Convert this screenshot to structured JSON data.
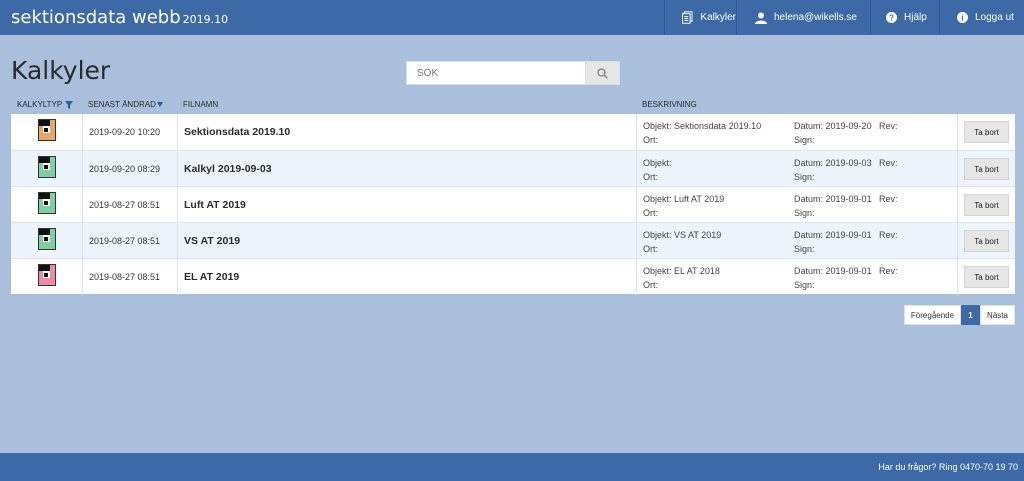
{
  "app": {
    "brand": "sektionsdata webb",
    "version": "2019.10"
  },
  "nav": {
    "calculations": "Kalkyler",
    "user": "helena@wikells.se",
    "help": "Hjälp",
    "logout": "Logga ut"
  },
  "page": {
    "title": "Kalkyler"
  },
  "search": {
    "placeholder": "SÖK"
  },
  "columns": {
    "type": "KALKYLTYP",
    "modified": "SENAST ÄNDRAD",
    "filename": "FILNAMN",
    "description": "BESKRIVNING"
  },
  "labels": {
    "object": "Objekt:",
    "place": "Ort:",
    "date": "Datum:",
    "sign": "Sign:",
    "rev": "Rev:",
    "delete": "Ta bort"
  },
  "rows": [
    {
      "modified": "2019-09-20 10:20",
      "filename": "Sektionsdata 2019.10",
      "object": "Sektionsdata 2019.10",
      "date": "2019-09-20",
      "icon": "calc-type-orange-icon",
      "color": "#e8a76a"
    },
    {
      "modified": "2019-09-20 08:29",
      "filename": "Kalkyl 2019-09-03",
      "object": "",
      "date": "2019-09-03",
      "icon": "calc-type-green-icon",
      "color": "#7fcfa3"
    },
    {
      "modified": "2019-08-27 08:51",
      "filename": "Luft AT 2019",
      "object": "Luft AT 2019",
      "date": "2019-09-01",
      "icon": "calc-type-green-icon",
      "color": "#7fcfa3"
    },
    {
      "modified": "2019-08-27 08:51",
      "filename": "VS AT 2019",
      "object": "VS AT 2019",
      "date": "2019-09-01",
      "icon": "calc-type-green-icon",
      "color": "#7fcfa3"
    },
    {
      "modified": "2019-08-27 08:51",
      "filename": "EL AT 2019",
      "object": "EL AT 2018",
      "date": "2019-09-01",
      "icon": "calc-type-pink-icon",
      "color": "#ef8aa6"
    }
  ],
  "pagination": {
    "previous": "Föregående",
    "current": "1",
    "next": "Nästa"
  },
  "footer": {
    "contact": "Har du frågor? Ring 0470-70 19 70"
  },
  "colors": {
    "header": "#3d6aa6",
    "background": "#a9bfdc",
    "row_alt": "#eef4fb"
  }
}
